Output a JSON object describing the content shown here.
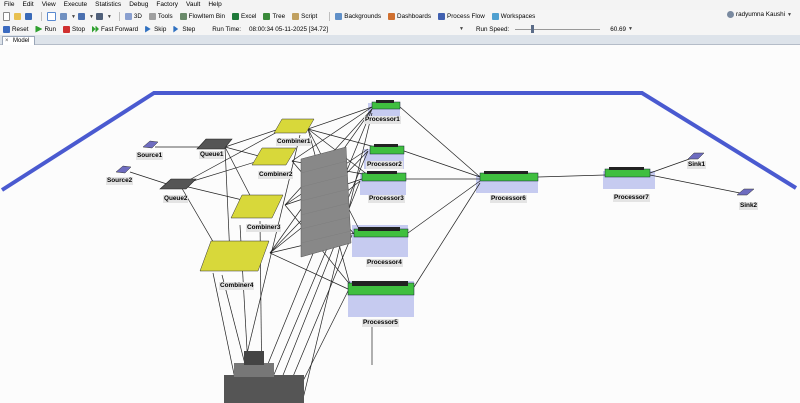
{
  "menu": [
    "File",
    "Edit",
    "View",
    "Execute",
    "Statistics",
    "Debug",
    "Factory",
    "Vault",
    "Help"
  ],
  "toolbar": {
    "btn_3d": "3D",
    "btn_tools": "Tools",
    "btn_flowitem_bin": "FlowItem Bin",
    "btn_excel": "Excel",
    "btn_tree": "Tree",
    "btn_script": "Script",
    "btn_backgrounds": "Backgrounds",
    "btn_dashboards": "Dashboards",
    "btn_process_flow": "Process Flow",
    "btn_workspaces": "Workspaces",
    "user_name": "radyumna Kaushi"
  },
  "run_controls": {
    "reset": "Reset",
    "run": "Run",
    "stop": "Stop",
    "fast_forward": "Fast Forward",
    "skip": "Skip",
    "step": "Step",
    "run_time_label": "Run Time:",
    "run_time_value": "08:00:34  05-11-2025  [34.72]",
    "run_speed_label": "Run Speed:",
    "run_speed_value": "60.69"
  },
  "tab": {
    "label": "Model"
  },
  "model": {
    "source1": "Source1",
    "source2": "Source2",
    "queue1": "Queue1",
    "queue2": "Queue2",
    "combiner1": "Combiner1",
    "combiner2": "Combiner2",
    "combiner3": "Combiner3",
    "combiner4": "Combiner4",
    "processor1": "Processor1",
    "processor2": "Processor2",
    "processor3": "Processor3",
    "processor4": "Processor4",
    "processor5": "Processor5",
    "processor6": "Processor6",
    "processor7": "Processor7",
    "sink1": "Sink1",
    "sink2": "Sink2"
  },
  "colors": {
    "floor_border": "#4a5ad0",
    "machine_green": "#3fbf3f",
    "combiner_yellow": "#d8d83a",
    "conveyor_gray": "#888888",
    "processor_shadow": "#c6cbf0"
  }
}
